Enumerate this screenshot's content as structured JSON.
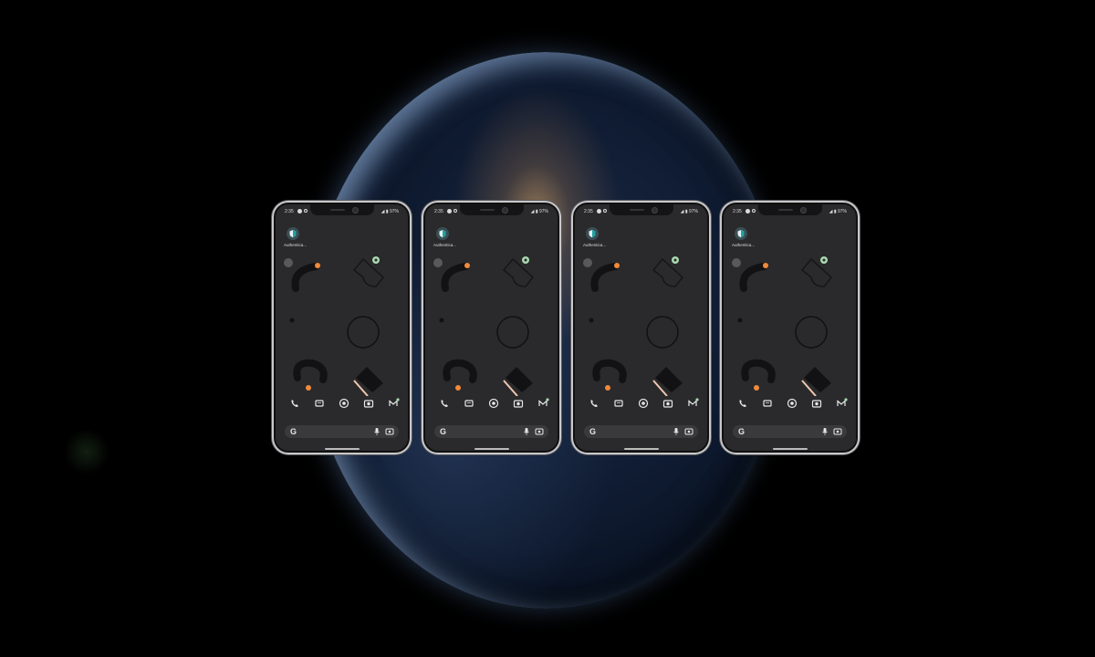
{
  "phones": [
    {
      "time": "2:35",
      "battery": "97%",
      "app_label": "Authentica..."
    },
    {
      "time": "2:35",
      "battery": "97%",
      "app_label": "Authentica..."
    },
    {
      "time": "2:35",
      "battery": "97%",
      "app_label": "Authentica..."
    },
    {
      "time": "2:35",
      "battery": "97%",
      "app_label": "Authentica..."
    }
  ],
  "icons": {
    "app": "authenticator-shield-icon",
    "dock": [
      "phone-icon",
      "messages-icon",
      "chrome-icon",
      "camera-icon",
      "gmail-icon"
    ],
    "search": [
      "google-g-icon",
      "mic-icon",
      "lens-icon"
    ]
  },
  "colors": {
    "accent_orange": "#f08a3c",
    "accent_mint": "#a8d8b0",
    "accent_lavender": "#a9a6e0",
    "screen_bg": "#2a2a2c",
    "frame": "#c9c9cc"
  },
  "search_logo": "G"
}
